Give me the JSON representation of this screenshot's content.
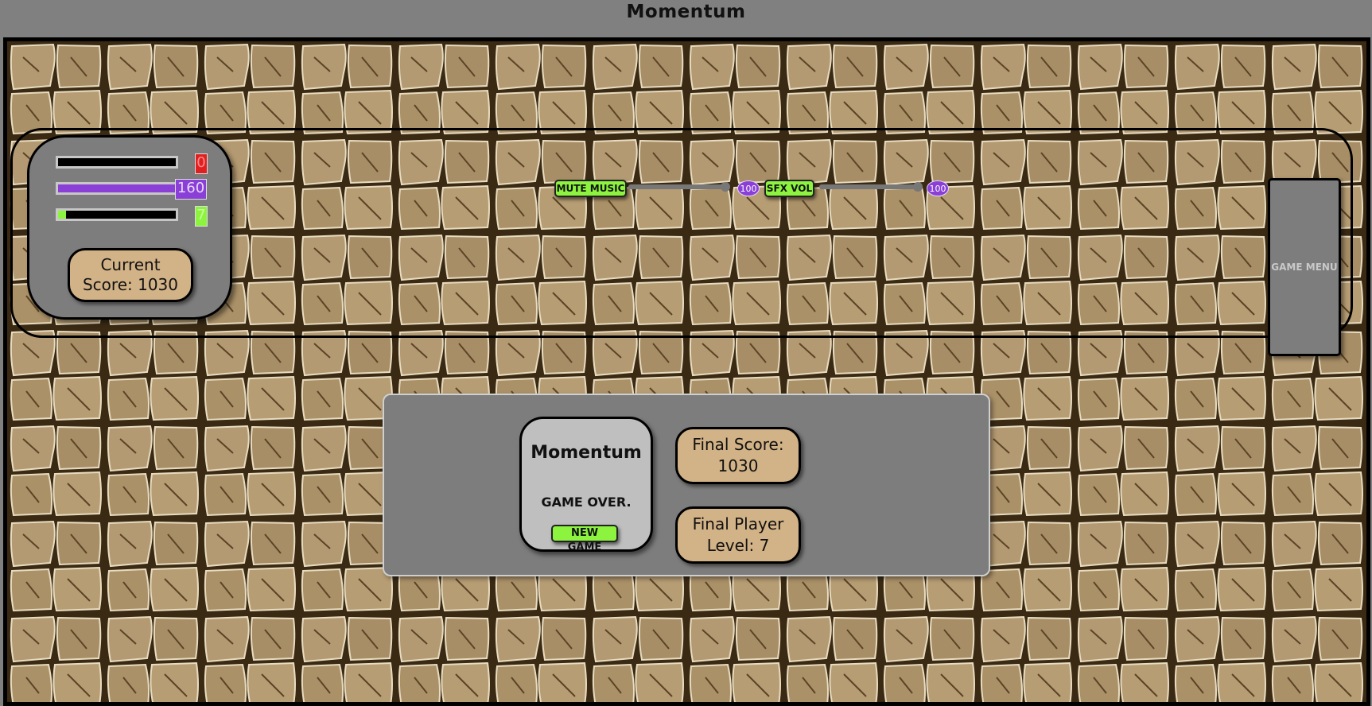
{
  "page_title": "Momentum",
  "hud": {
    "bars": [
      {
        "label_value": "0",
        "fill_fraction": 0.0,
        "fill_color": "#000000",
        "badge_bg": "#e02020",
        "badge_text_color": "#ff8a8a"
      },
      {
        "label_value": "160",
        "fill_fraction": 1.0,
        "fill_color": "#8a3fd6",
        "badge_bg": "#8a3fd6",
        "badge_text_color": "#e9d9ff"
      },
      {
        "label_value": "7",
        "fill_fraction": 0.07,
        "fill_color": "#8cf43e",
        "badge_bg": "#8cf43e",
        "badge_text_color": "#c7ff9a"
      }
    ],
    "current_score_label": "Current",
    "current_score_text": "Score: 1030"
  },
  "audio": {
    "mute_music_label": "MUTE MUSIC",
    "music_volume": "100",
    "sfx_label": "SFX VOL",
    "sfx_volume": "100"
  },
  "game_menu_label": "GAME MENU",
  "game_over": {
    "title": "Momentum",
    "message": "GAME OVER.",
    "new_game_label": "NEW GAME",
    "final_score_label": "Final Score:",
    "final_score_value": "1030",
    "final_level_label": "Final Player",
    "final_level_value": "Level: 7"
  },
  "colors": {
    "accent_green": "#8cf43e",
    "accent_purple": "#8a3fd6",
    "panel_gray": "#7d7d7d",
    "tan": "#d2b287"
  }
}
